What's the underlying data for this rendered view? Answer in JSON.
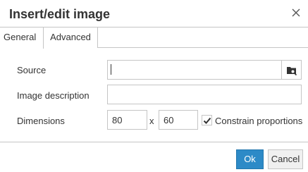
{
  "dialog": {
    "title": "Insert/edit image",
    "close_icon": "close-icon"
  },
  "tabs": [
    {
      "label": "General",
      "active": true
    },
    {
      "label": "Advanced",
      "active": false
    }
  ],
  "fields": {
    "source": {
      "label": "Source",
      "value": "",
      "browse_icon": "browse-image-icon"
    },
    "description": {
      "label": "Image description",
      "value": ""
    },
    "dimensions": {
      "label": "Dimensions",
      "width": "80",
      "height": "60",
      "separator": "x"
    },
    "constrain": {
      "label": "Constrain proportions",
      "checked": true
    }
  },
  "buttons": {
    "ok": "Ok",
    "cancel": "Cancel"
  },
  "colors": {
    "primary": "#2d8ac7",
    "border": "#c5c5c5"
  }
}
